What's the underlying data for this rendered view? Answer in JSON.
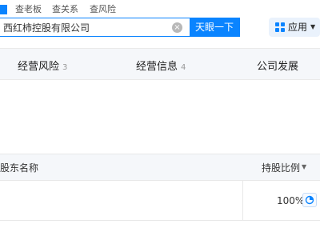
{
  "header": {
    "tabs": [
      "查老板",
      "查关系",
      "查风险"
    ],
    "search": {
      "value": "西红柿控股有限公司"
    },
    "search_button": "天眼一下",
    "apps_button": "应用"
  },
  "section_tabs": [
    {
      "label": "经营风险",
      "count": "3"
    },
    {
      "label": "经营信息",
      "count": "4"
    },
    {
      "label": "公司发展",
      "count": ""
    }
  ],
  "shareholders": {
    "columns": [
      "股东名称",
      "持股比例"
    ],
    "rows": [
      {
        "name": "",
        "ratio": "100%"
      }
    ]
  },
  "colors": {
    "accent": "#0a84ff",
    "panel_bg": "#f5f7fa"
  }
}
